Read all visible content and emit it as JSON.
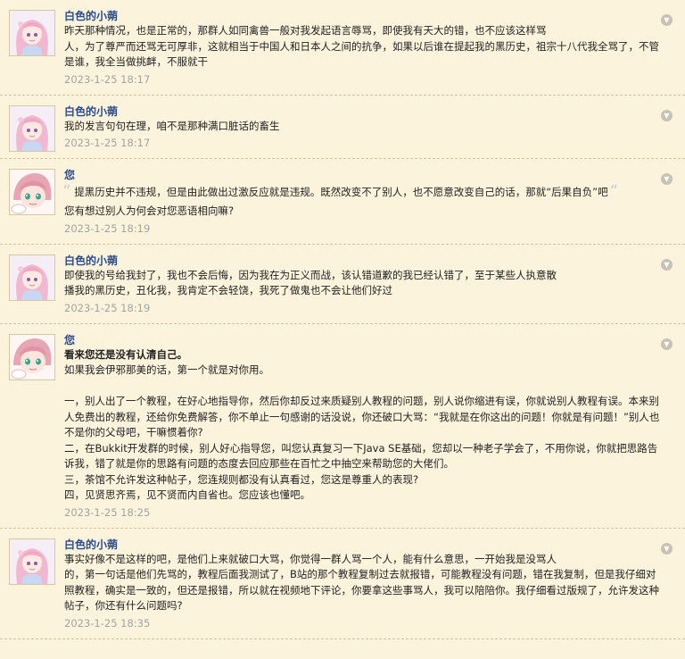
{
  "posts": [
    {
      "author": "白色的小蒴",
      "avatar": "pink-girl-avatar",
      "lines": [
        "昨天那种情况，也是正常的，那群人如同禽兽一般对我发起语言辱骂，即使我有天大的错，也不应该这样骂",
        "人，为了尊严而还骂无可厚非，这就相当于中国人和日本人之间的抗争，如果以后谁在提起我的黑历史，祖宗十八代我全骂了，不管是谁，我全当做挑衅，不服就干"
      ],
      "time": "2023-1-25 18:17"
    },
    {
      "author": "白色的小蒴",
      "avatar": "pink-girl-avatar",
      "lines": [
        "我的发言句句在理，咱不是那种满口脏话的畜生"
      ],
      "time": "2023-1-25 18:17"
    },
    {
      "author": "您",
      "avatar": "green-eyed-girl-avatar",
      "quote": "提黑历史并不违规，但是由此做出过激反应就是违规。既然改变不了别人，也不愿意改变自己的话，那就“后果自负”吧",
      "lines": [
        "您有想过别人为何会对您恶语相向嘛?"
      ],
      "time": "2023-1-25 18:19"
    },
    {
      "author": "白色的小蒴",
      "avatar": "pink-girl-avatar",
      "lines": [
        "即使我的号给我封了，我也不会后悔，因为我在为正义而战，该认错道歉的我已经认错了，至于某些人执意散",
        "播我的黑历史，丑化我，我肯定不会轻饶，我死了做鬼也不会让他们好过"
      ],
      "time": "2023-1-25 18:19"
    },
    {
      "author": "您",
      "avatar": "green-eyed-girl-avatar",
      "bold_line": "看来您还是没有认清自己。",
      "lines": [
        "如果我会伊邪那美的话，第一个就是对你用。",
        "",
        "一，别人出了一个教程，在好心地指导你，然后你却反过来质疑别人教程的问题，别人说你缩进有误，你就说别人教程有误。本来别人免费出的教程，还给你免费解答，你不单止一句感谢的话没说，你还破口大骂：“我就是在你这出的问题！你就是有问题！”别人也不是你的父母吧，干嘛惯着你?",
        "二，在Bukkit开发群的时候，别人好心指导您，叫您认真复习一下Java SE基础，您却以一种老子学会了，不用你说，你就把思路告诉我，错了就是你的思路有问题的态度去回应那些在百忙之中抽空来帮助您的大佬们。",
        "三，茶馆不允许发这种帖子，您连规则都没有认真看过，您这是尊重人的表现?",
        "四，见贤思齐焉，见不贤而内自省也。您应该也懂吧。"
      ],
      "time": "2023-1-25 18:25"
    },
    {
      "author": "白色的小蒴",
      "avatar": "pink-girl-avatar",
      "lines": [
        "事实好像不是这样的吧，是他们上来就破口大骂，你觉得一群人骂一个人，能有什么意思，一开始我是没骂人",
        "的，第一句话是他们先骂的，教程后面我测试了，B站的那个教程复制过去就报错，可能教程没有问题，错在我复制，但是我仔细对照教程，确实是一致的，但还是报错，所以就在视频地下评论，你要拿这些事骂人，我可以陪陪你。我仔细看过版规了，允许发这种帖子，你还有什么问题吗?"
      ],
      "time": "2023-1-25 18:35"
    }
  ]
}
